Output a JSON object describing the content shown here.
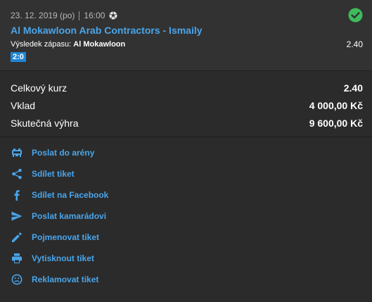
{
  "bet": {
    "date": "23. 12. 2019 (po)",
    "time": "16:00",
    "sport_icon": "soccer-ball-icon",
    "status_icon": "check-circle-icon",
    "match": "Al Mokawloon Arab Contractors - Ismaily",
    "result_label": "Výsledek zápasu:",
    "result_pick": "Al Mokawloon",
    "odd": "2.40",
    "score": "2:0"
  },
  "summary": {
    "rows": [
      {
        "label": "Celkový kurz",
        "value": "2.40"
      },
      {
        "label": "Vklad",
        "value": "4 000,00 Kč"
      },
      {
        "label": "Skutečná výhra",
        "value": "9 600,00 Kč"
      }
    ]
  },
  "actions": [
    {
      "label": "Poslat do arény",
      "icon": "arena-icon"
    },
    {
      "label": "Sdílet tiket",
      "icon": "share-icon"
    },
    {
      "label": "Sdílet na Facebook",
      "icon": "facebook-icon"
    },
    {
      "label": "Poslat kamarádovi",
      "icon": "send-icon"
    },
    {
      "label": "Pojmenovat tiket",
      "icon": "pencil-icon"
    },
    {
      "label": "Vytisknout tiket",
      "icon": "printer-icon"
    },
    {
      "label": "Reklamovat tiket",
      "icon": "sad-face-icon"
    }
  ],
  "colors": {
    "accent": "#4aa5ea",
    "success": "#3dbb5b",
    "score_badge": "#1f87d6"
  }
}
